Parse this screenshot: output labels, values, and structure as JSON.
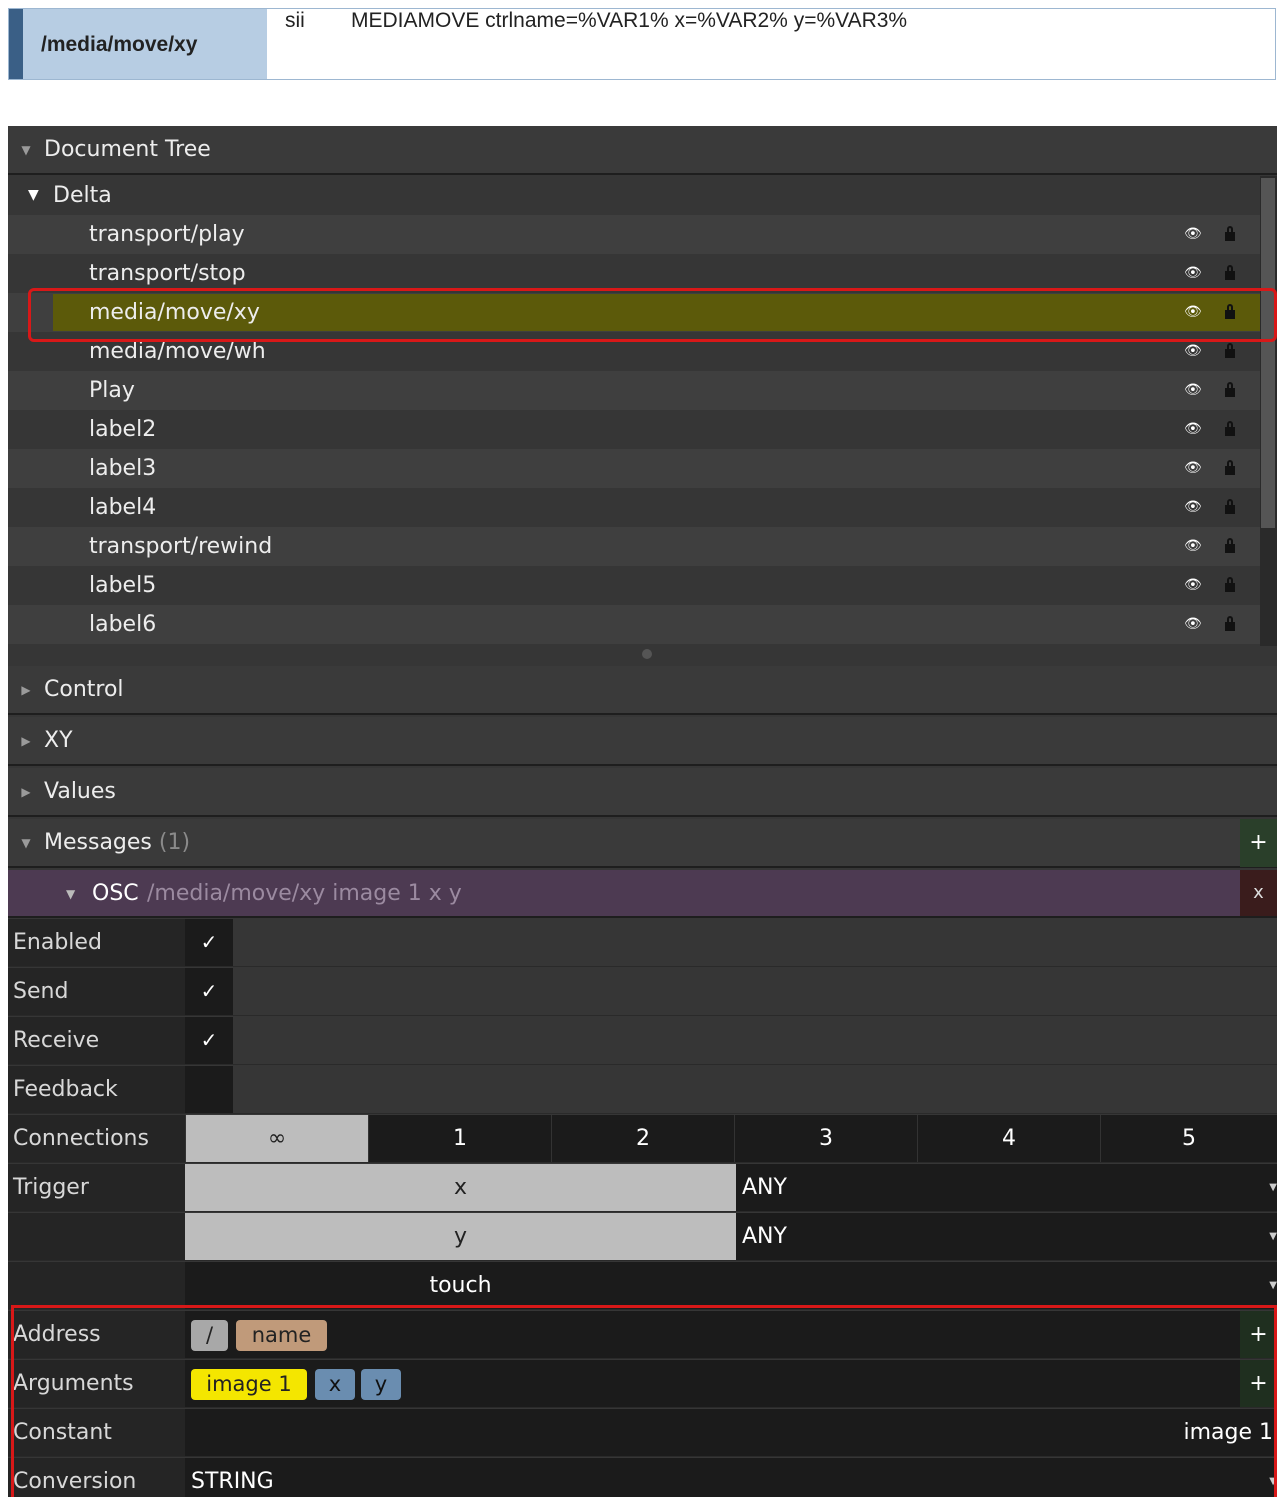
{
  "osc_bar": {
    "address": "/media/move/xy",
    "type_tag": "sii",
    "command": "MEDIAMOVE ctrlname=%VAR1% x=%VAR2% y=%VAR3%"
  },
  "document_tree": {
    "title": "Document Tree",
    "root": "Delta",
    "items": [
      {
        "label": "transport/play"
      },
      {
        "label": "transport/stop"
      },
      {
        "label": "media/move/xy"
      },
      {
        "label": "media/move/wh"
      },
      {
        "label": "Play"
      },
      {
        "label": "label2"
      },
      {
        "label": "label3"
      },
      {
        "label": "label4"
      },
      {
        "label": "transport/rewind"
      },
      {
        "label": "label5"
      },
      {
        "label": "label6"
      }
    ],
    "selected_index": 2
  },
  "sections": {
    "control": "Control",
    "xy": "XY",
    "values": "Values",
    "messages": "Messages",
    "messages_count": "(1)",
    "plus": "+"
  },
  "osc_message": {
    "kind": "OSC",
    "path": "/media/move/xy image 1 x y",
    "close": "x"
  },
  "props": {
    "enabled": {
      "label": "Enabled",
      "value": "✓"
    },
    "send": {
      "label": "Send",
      "value": "✓"
    },
    "receive": {
      "label": "Receive",
      "value": "✓"
    },
    "feedback": {
      "label": "Feedback",
      "value": ""
    },
    "connections": {
      "label": "Connections",
      "options": [
        "∞",
        "1",
        "2",
        "3",
        "4",
        "5"
      ]
    },
    "trigger": {
      "label": "Trigger",
      "rows": [
        {
          "name": "x",
          "mode": "ANY"
        },
        {
          "name": "y",
          "mode": "ANY"
        },
        {
          "name": "touch",
          "mode": ""
        }
      ]
    },
    "address": {
      "label": "Address",
      "parts": [
        "/",
        "name"
      ]
    },
    "arguments": {
      "label": "Arguments",
      "parts": [
        "image 1",
        "x",
        "y"
      ]
    },
    "constant": {
      "label": "Constant",
      "value": "image 1"
    },
    "conversion": {
      "label": "Conversion",
      "value": "STRING"
    }
  },
  "colors": {
    "highlight_row": "#5c5a0a",
    "annotation_red": "#d81818",
    "osc_header": "#4d3a52",
    "tag_yellow": "#f4e600",
    "tag_blue": "#6a8db0",
    "tag_tan": "#c09a7a"
  }
}
